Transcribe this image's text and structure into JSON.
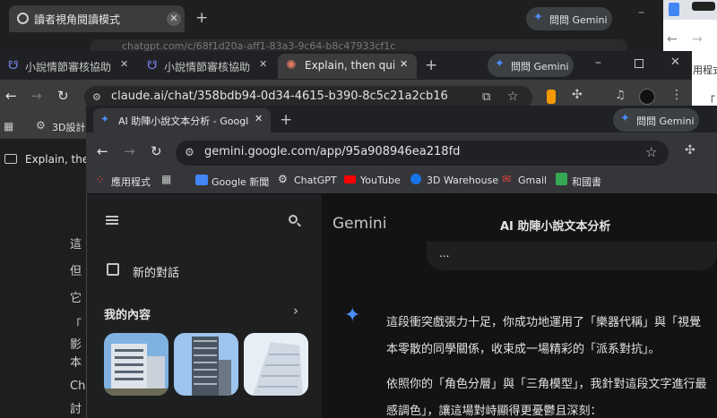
{
  "window_back": {
    "tab_title": "讀者視角閱讀模式",
    "gemini_chip": "問問 Gemini",
    "url_partial": "chatgpt.com/c/68f1d20a-aff1-83a3-9c64-b8c47933cf1c"
  },
  "window_mid": {
    "tabs": [
      {
        "label": "小說情節審核協助 - ["
      },
      {
        "label": "小說情節審核協助 - ["
      },
      {
        "label": "Explain, then quiz m"
      }
    ],
    "gemini_chip": "問問 Gemini",
    "url": "claude.ai/chat/358bdb94-0d34-4615-b390-8c5c21a2cb16",
    "bookmark_partial": "3D設計",
    "chat_title_partial": "Explain, then",
    "content_fragments": [
      "這",
      "但",
      "它",
      "「",
      "影",
      "本",
      "Ch",
      "討"
    ]
  },
  "window_far_right": {
    "label": "應用程式",
    "label2": "「"
  },
  "window_front": {
    "tab_title": "AI 助陣小說文本分析 - Google",
    "gemini_chip": "問問 Gemini",
    "url": "gemini.google.com/app/95a908946ea218fd",
    "bookmarks": [
      {
        "label": "應用程式"
      },
      {
        "label": "Google 新聞"
      },
      {
        "label": "ChatGPT"
      },
      {
        "label": "YouTube"
      },
      {
        "label": "3D Warehouse"
      },
      {
        "label": "Gmail"
      },
      {
        "label": "和國書"
      }
    ],
    "app": {
      "brand": "Gemini",
      "chat_title": "AI 助陣小說文本分析",
      "new_chat": "新的對話",
      "my_content": "我的內容",
      "ellipsis": "...",
      "response_lines": [
        "這段衝突戲張力十足，你成功地運用了「樂器代稱」與「視覺",
        "本零散的同學關係，收束成一場精彩的「派系對抗」。",
        "依照你的「角色分層」與「三角模型」，我針對這段文字進行最",
        "感調色」，讓這場對峙顯得更憂鬱且深刻："
      ]
    }
  },
  "colors": {
    "gemini_blue": "#4b8df7",
    "chrome_dark": "#35363a",
    "page_dark": "#131314"
  }
}
